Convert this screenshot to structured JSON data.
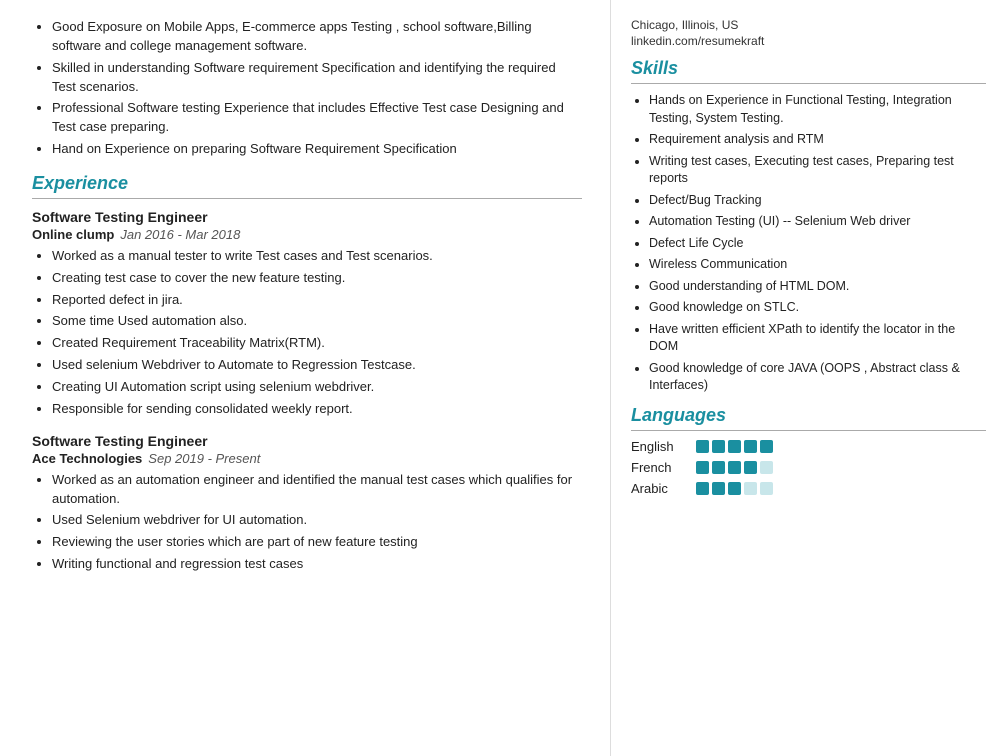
{
  "left": {
    "objective_bullets": [
      "Good Exposure on Mobile Apps, E-commerce apps Testing , school software,Billing software and college management software.",
      "Skilled in understanding Software requirement Specification and identifying the required Test scenarios.",
      "Professional Software testing Experience that includes Effective Test case Designing and Test case preparing.",
      "Hand on Experience on preparing Software Requirement Specification"
    ],
    "experience_section_title": "Experience",
    "experiences": [
      {
        "title": "Software Testing Engineer",
        "company": "Online clump",
        "dates": "Jan 2016 - Mar 2018",
        "bullets": [
          "Worked as a manual tester to write Test cases and Test scenarios.",
          "Creating test case to cover the new feature testing.",
          "Reported defect in jira.",
          "Some time Used automation also.",
          "Created Requirement Traceability Matrix(RTM).",
          "Used selenium Webdriver to Automate to Regression Testcase.",
          "Creating UI Automation script using selenium  webdriver.",
          "Responsible for sending consolidated weekly report."
        ]
      },
      {
        "title": "Software Testing Engineer",
        "company": "Ace Technologies",
        "dates": "Sep 2019 - Present",
        "bullets": [
          "Worked as an automation engineer and identified the manual test cases which qualifies for automation.",
          "Used Selenium webdriver for UI automation.",
          "Reviewing the user stories which are part of new feature testing",
          "Writing functional and regression test cases"
        ]
      }
    ]
  },
  "right": {
    "location": "Chicago, Illinois, US",
    "linkedin": "linkedin.com/resumekraft",
    "skills_section_title": "Skills",
    "skills": [
      "Hands on Experience in Functional Testing, Integration Testing, System Testing.",
      "Requirement analysis and RTM",
      "Writing test cases, Executing test cases, Preparing test reports",
      "Defect/Bug Tracking",
      "Automation Testing (UI) -- Selenium Web driver",
      "Defect Life Cycle",
      "Wireless Communication",
      "Good understanding of HTML DOM.",
      "Good knowledge on STLC.",
      "Have written efficient XPath to identify the locator in the DOM",
      "Good knowledge of core JAVA (OOPS , Abstract class & Interfaces)"
    ],
    "languages_section_title": "Languages",
    "languages": [
      {
        "name": "English",
        "filled": 5,
        "empty": 0
      },
      {
        "name": "French",
        "filled": 4,
        "empty": 1
      },
      {
        "name": "Arabic",
        "filled": 3,
        "empty": 2
      }
    ]
  }
}
